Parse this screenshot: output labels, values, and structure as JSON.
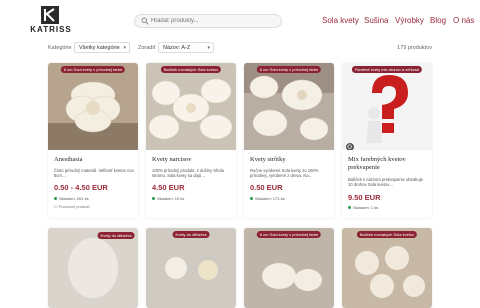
{
  "header": {
    "logo_text": "KATRISS",
    "search_placeholder": "Hľadať produkty...",
    "nav": [
      "Sola kvety",
      "Sušina",
      "Výrobky",
      "Blog",
      "O nás"
    ]
  },
  "filters": {
    "category_label": "Kategórie",
    "category_value": "Všetky kategórie",
    "sort_label": "Zoradiť",
    "sort_value": "Názov: A-Z",
    "count": "179 produktov"
  },
  "colors": {
    "accent": "#9b2a3a",
    "badge": "#8b2332",
    "stock": "#2a9d4a"
  },
  "products": [
    {
      "badge": "6 cm Sola kvety v prírodnej farbe",
      "title": "Anesthasia",
      "desc": "Čisto prírodný materiál. Veľkosť kvetov cca 6cm…",
      "price": "0.50 - 4.50 EUR",
      "stock": "Skladom: 261 ks",
      "compare": "Porovnať produkt"
    },
    {
      "badge": "Balíček rovnakých Sola kvetov",
      "title": "Kvety narcisov",
      "desc": "100% prírodný produkt, z dužiny Shola stromu. Sola kvety sa dajú…",
      "price": "4.50 EUR",
      "stock": "Skladom: 10 ks"
    },
    {
      "badge": "6 cm Sola kvety v prírodnej farbe",
      "title": "Kvety sirôtky",
      "desc": "Ručne vyrobené Sola kvety zo 100% prírodnej, vyrobené z dreva. Na…",
      "price": "0.50 EUR",
      "stock": "Skladom: 173 ks"
    },
    {
      "badge": "Farebné kvety mix druhov a veľkostí",
      "title": "Mix farebných kvetov prekvapenie",
      "desc": "Balíček s názvom prekvapenie obsahuje 10 druhov Sola kvetov…",
      "price": "9.50 EUR",
      "stock": "Skladom: 1 ks"
    }
  ],
  "row2_badges": [
    "Kvety do difúzéra",
    "Kvety do difúzéra",
    "6 cm Sola kvety v prírodnej farbe",
    "Balíček rovnakých Sola kvetov"
  ]
}
